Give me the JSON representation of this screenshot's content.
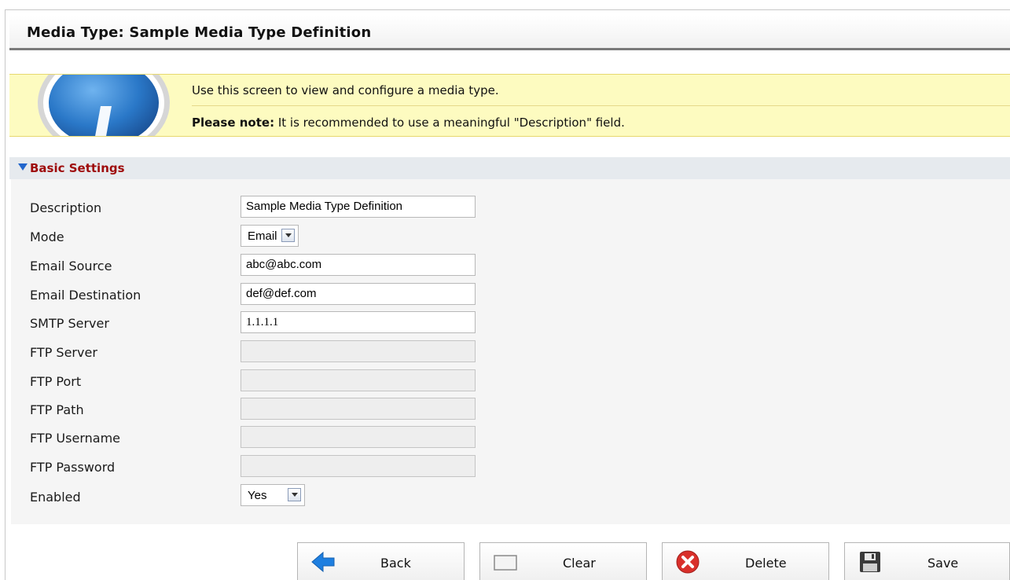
{
  "header": {
    "title": "Media Type: Sample Media Type Definition"
  },
  "info": {
    "line1": "Use this screen to view and configure a media type.",
    "note_label": "Please note:",
    "note_text": " It is recommended to use a meaningful \"Description\" field."
  },
  "section": {
    "title": "Basic Settings"
  },
  "form": {
    "description": {
      "label": "Description",
      "value": "Sample Media Type Definition"
    },
    "mode": {
      "label": "Mode",
      "value": "Email"
    },
    "email_source": {
      "label": "Email Source",
      "value": "abc@abc.com"
    },
    "email_destination": {
      "label": "Email Destination",
      "value": "def@def.com"
    },
    "smtp_server": {
      "label": "SMTP Server",
      "value": "1.1.1.1"
    },
    "ftp_server": {
      "label": "FTP Server",
      "value": ""
    },
    "ftp_port": {
      "label": "FTP Port",
      "value": ""
    },
    "ftp_path": {
      "label": "FTP Path",
      "value": ""
    },
    "ftp_username": {
      "label": "FTP Username",
      "value": ""
    },
    "ftp_password": {
      "label": "FTP Password",
      "value": ""
    },
    "enabled": {
      "label": "Enabled",
      "value": "Yes"
    }
  },
  "buttons": {
    "back": "Back",
    "clear": "Clear",
    "delete": "Delete",
    "save": "Save"
  },
  "colors": {
    "info_background": "#fdfbc0",
    "section_title": "#9e0b0b",
    "section_arrow": "#2266cc",
    "back_arrow": "#1e7fe0",
    "delete_icon": "#d9302b"
  }
}
